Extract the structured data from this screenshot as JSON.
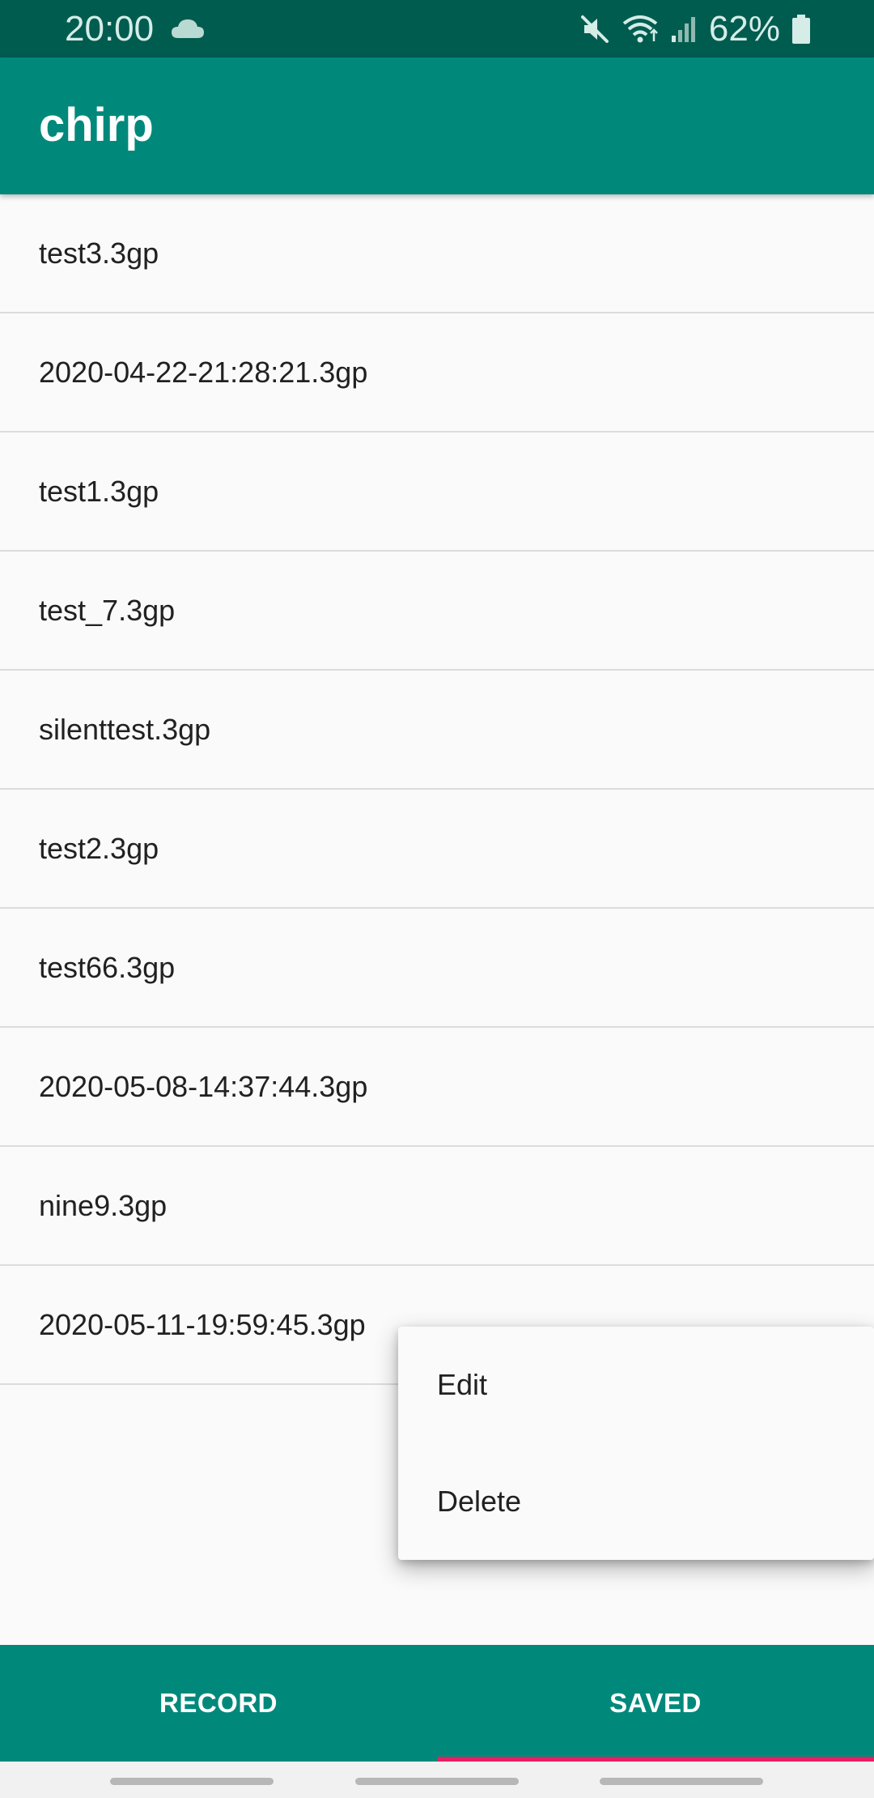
{
  "status_bar": {
    "time": "20:00",
    "cloud_icon": "cloud-icon",
    "mute_icon": "muted-speaker-icon",
    "wifi_icon": "wifi-icon",
    "signal_icon": "cell-signal-icon",
    "battery_percent": "62%",
    "battery_icon": "battery-icon"
  },
  "app_bar": {
    "title": "chirp"
  },
  "files": [
    "test3.3gp",
    "2020-04-22-21:28:21.3gp",
    "test1.3gp",
    "test_7.3gp",
    "silenttest.3gp",
    "test2.3gp",
    "test66.3gp",
    "2020-05-08-14:37:44.3gp",
    "nine9.3gp",
    "2020-05-11-19:59:45.3gp"
  ],
  "context_menu": {
    "items": [
      {
        "label": "Edit"
      },
      {
        "label": "Delete"
      }
    ]
  },
  "tabs": [
    {
      "label": "RECORD",
      "selected": false
    },
    {
      "label": "SAVED",
      "selected": true
    }
  ],
  "colors": {
    "status_bar": "#005c4f",
    "primary": "#00897b",
    "tab_indicator": "#e91e63",
    "background": "#fafafa"
  }
}
